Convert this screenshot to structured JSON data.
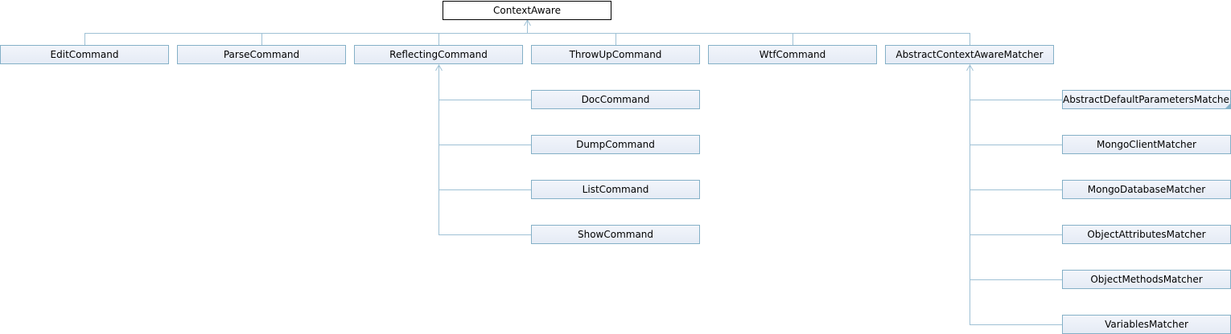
{
  "diagram": {
    "colors": {
      "edge": "#9fc1d5",
      "node_border": "#84b0c7",
      "node_fill": "#e5ebf5",
      "root_border": "#000000"
    },
    "root": {
      "label": "ContextAware"
    },
    "level1": [
      {
        "label": "EditCommand"
      },
      {
        "label": "ParseCommand"
      },
      {
        "label": "ReflectingCommand"
      },
      {
        "label": "ThrowUpCommand"
      },
      {
        "label": "WtfCommand"
      },
      {
        "label": "AbstractContextAwareMatcher"
      }
    ],
    "reflecting_children": [
      {
        "label": "DocCommand"
      },
      {
        "label": "DumpCommand"
      },
      {
        "label": "ListCommand"
      },
      {
        "label": "ShowCommand"
      }
    ],
    "matcher_children": [
      {
        "label": "AbstractDefaultParametersMatcher",
        "has_more": true
      },
      {
        "label": "MongoClientMatcher"
      },
      {
        "label": "MongoDatabaseMatcher"
      },
      {
        "label": "ObjectAttributesMatcher"
      },
      {
        "label": "ObjectMethodsMatcher"
      },
      {
        "label": "VariablesMatcher"
      }
    ]
  }
}
